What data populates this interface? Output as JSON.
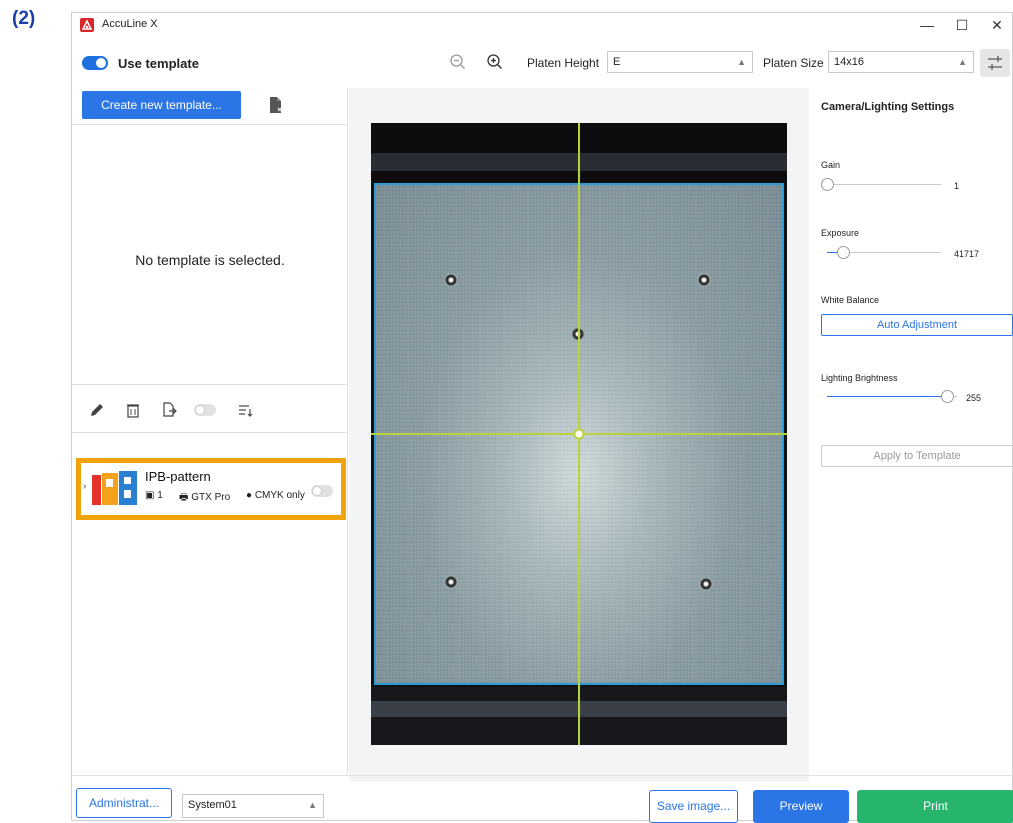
{
  "figure_label": "(2)",
  "window": {
    "title": "AccuLine X",
    "minimize": "—",
    "maximize": "☐",
    "close": "✕"
  },
  "toolbar": {
    "use_template_label": "Use template",
    "use_template_on": true,
    "platen_height_label": "Platen Height",
    "platen_height_value": "E",
    "platen_size_label": "Platen Size",
    "platen_size_value": "14x16"
  },
  "left_panel": {
    "create_button": "Create new template...",
    "empty_message": "No template is selected.",
    "template_item": {
      "name": "IPB-pattern",
      "image_count": "1",
      "printer": "GTX Pro",
      "color_mode": "CMYK only",
      "logo_text": "IPB"
    }
  },
  "right_panel": {
    "title": "Camera/Lighting Settings",
    "gain_label": "Gain",
    "gain_value": "1",
    "exposure_label": "Exposure",
    "exposure_value": "41717",
    "white_balance_label": "White Balance",
    "auto_adjust_button": "Auto Adjustment",
    "lighting_label": "Lighting Brightness",
    "lighting_value": "255",
    "apply_button": "Apply to Template"
  },
  "footer": {
    "admin_button": "Administrat...",
    "system_select": "System01",
    "save_button": "Save image...",
    "preview_button": "Preview",
    "print_button": "Print"
  },
  "colors": {
    "accent_blue": "#2b75e6",
    "print_green": "#27b56e",
    "highlight_orange": "#f0a30a",
    "crosshair": "#b9d23a",
    "frame_blue": "#2e9ad6"
  }
}
